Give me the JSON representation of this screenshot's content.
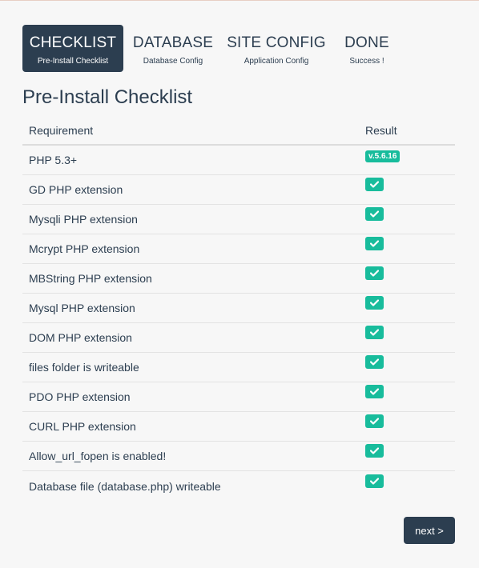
{
  "steps": [
    {
      "title": "CHECKLIST",
      "subtitle": "Pre-Install Checklist",
      "active": true
    },
    {
      "title": "DATABASE",
      "subtitle": "Database Config",
      "active": false
    },
    {
      "title": "SITE CONFIG",
      "subtitle": "Application Config",
      "active": false
    },
    {
      "title": "DONE",
      "subtitle": "Success !",
      "active": false
    }
  ],
  "page_title": "Pre-Install Checklist",
  "table": {
    "headers": {
      "requirement": "Requirement",
      "result": "Result"
    },
    "rows": [
      {
        "requirement": "PHP 5.3+",
        "result": "v.5.6.16"
      },
      {
        "requirement": "GD PHP extension",
        "result": "check"
      },
      {
        "requirement": "Mysqli PHP extension",
        "result": "check"
      },
      {
        "requirement": "Mcrypt PHP extension",
        "result": "check"
      },
      {
        "requirement": "MBString PHP extension",
        "result": "check"
      },
      {
        "requirement": "Mysql PHP extension",
        "result": "check"
      },
      {
        "requirement": "DOM PHP extension",
        "result": "check"
      },
      {
        "requirement": "files folder is writeable",
        "result": "check"
      },
      {
        "requirement": "PDO PHP extension",
        "result": "check"
      },
      {
        "requirement": "CURL PHP extension",
        "result": "check"
      },
      {
        "requirement": "Allow_url_fopen is enabled!",
        "result": "check"
      },
      {
        "requirement": "Database file (database.php) writeable",
        "result": "check"
      }
    ]
  },
  "next_label": "next >",
  "colors": {
    "primary": "#2c3e50",
    "success": "#18bc9c",
    "background": "#f7f7f7"
  }
}
